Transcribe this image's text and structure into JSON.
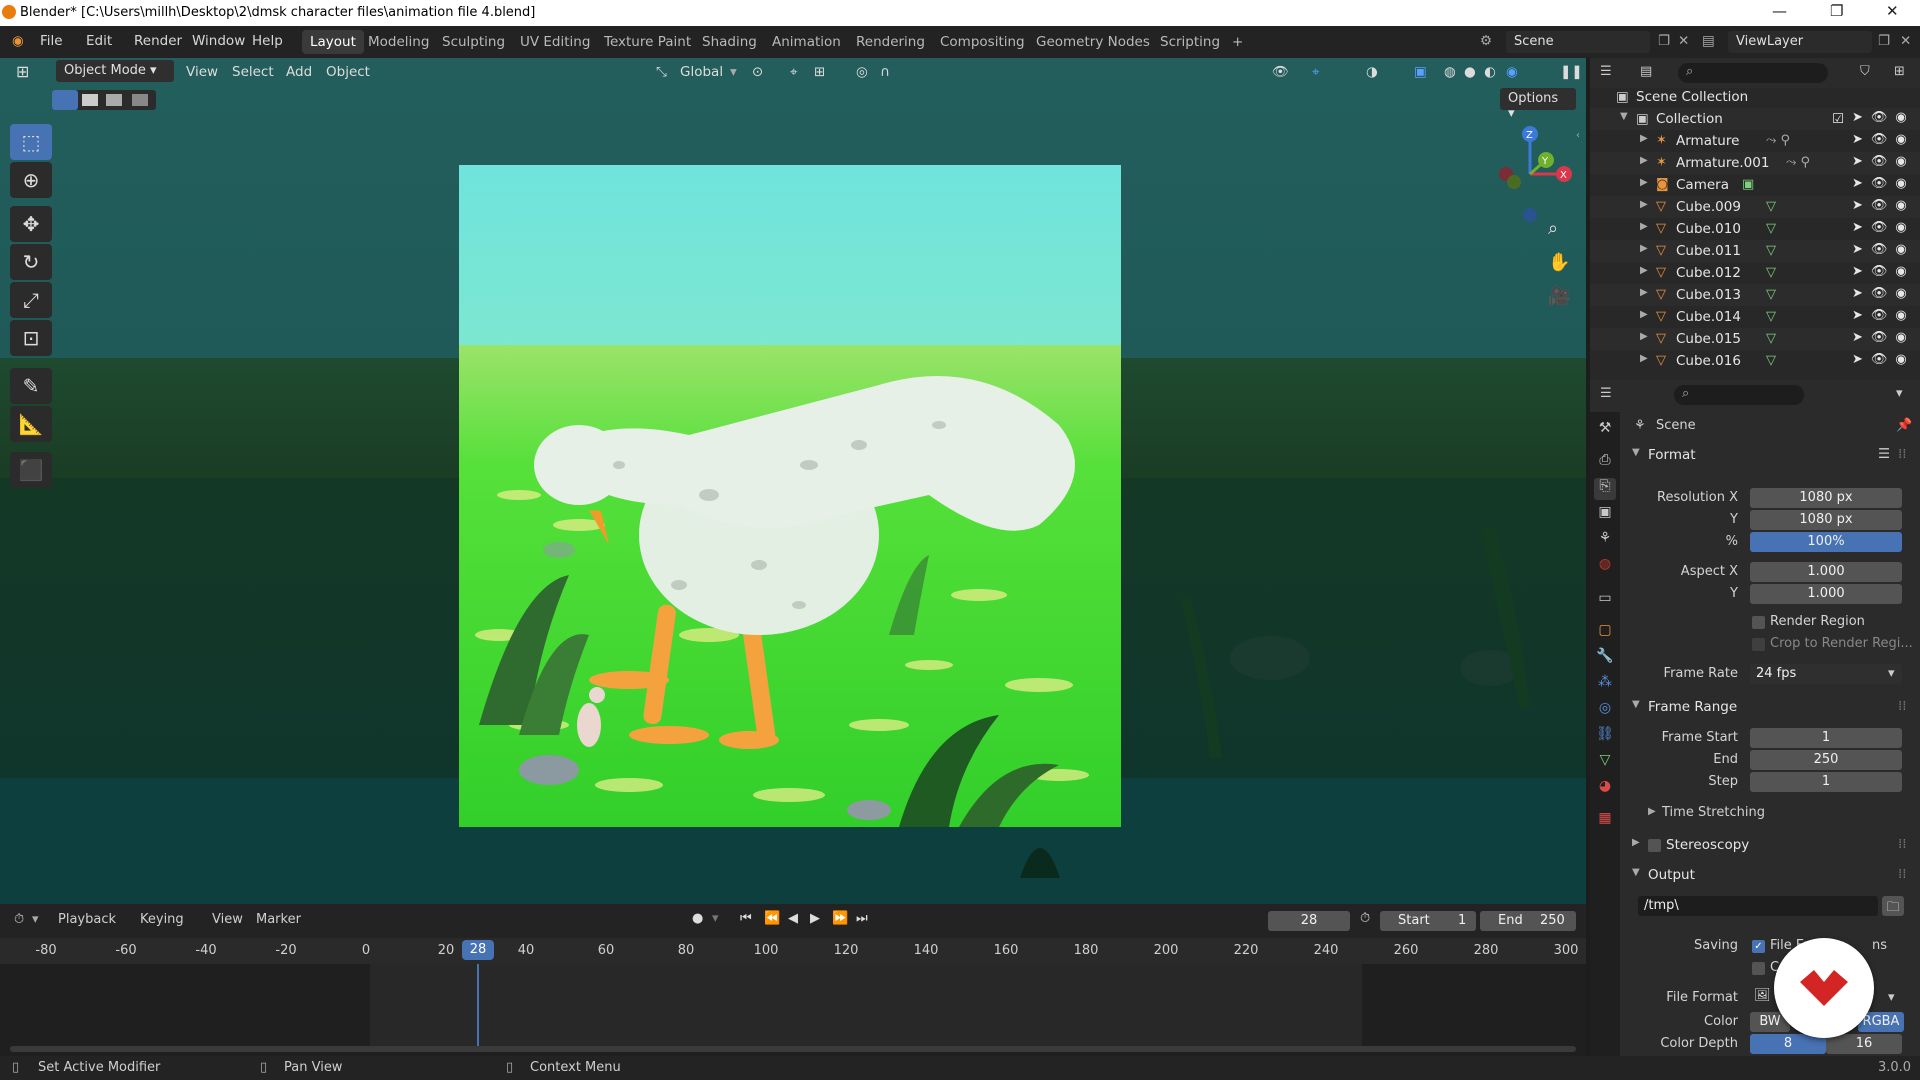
{
  "window": {
    "title": "Blender* [C:\\Users\\millh\\Desktop\\2\\dmsk character files\\animation file 4.blend]",
    "controls": [
      "—",
      "❐",
      "✕"
    ]
  },
  "menu": [
    "File",
    "Edit",
    "Render",
    "Window",
    "Help"
  ],
  "workspaces": [
    "Layout",
    "Modeling",
    "Sculpting",
    "UV Editing",
    "Texture Paint",
    "Shading",
    "Animation",
    "Rendering",
    "Compositing",
    "Geometry Nodes",
    "Scripting"
  ],
  "active_workspace": "Layout",
  "add_workspace": "+",
  "scene_field": "Scene",
  "viewlayer_field": "ViewLayer",
  "viewport_header": {
    "mode": "Object Mode",
    "menus": [
      "View",
      "Select",
      "Add",
      "Object"
    ],
    "transform": "Global",
    "options": "Options"
  },
  "gizmo": {
    "z": "Z",
    "y": "Y",
    "x": "X"
  },
  "tools": [
    "select-box",
    "cursor",
    "move",
    "rotate",
    "scale",
    "transform",
    "annotate",
    "measure",
    "add-cube"
  ],
  "outliner": {
    "root": "Scene Collection",
    "collection": "Collection",
    "items": [
      {
        "name": "Armature",
        "icon": "armature-icon"
      },
      {
        "name": "Armature.001",
        "icon": "armature-icon"
      },
      {
        "name": "Camera",
        "icon": "camera-icon"
      },
      {
        "name": "Cube.009",
        "icon": "mesh-icon"
      },
      {
        "name": "Cube.010",
        "icon": "mesh-icon"
      },
      {
        "name": "Cube.011",
        "icon": "mesh-icon"
      },
      {
        "name": "Cube.012",
        "icon": "mesh-icon"
      },
      {
        "name": "Cube.013",
        "icon": "mesh-icon"
      },
      {
        "name": "Cube.014",
        "icon": "mesh-icon"
      },
      {
        "name": "Cube.015",
        "icon": "mesh-icon"
      },
      {
        "name": "Cube.016",
        "icon": "mesh-icon"
      }
    ]
  },
  "properties": {
    "context": "Scene",
    "format": {
      "title": "Format",
      "res_x_label": "Resolution X",
      "res_x": "1080 px",
      "res_y_label": "Y",
      "res_y": "1080 px",
      "res_pct_label": "%",
      "res_pct": "100%",
      "aspect_x_label": "Aspect X",
      "aspect_x": "1.000",
      "aspect_y_label": "Y",
      "aspect_y": "1.000",
      "render_region": "Render Region",
      "crop": "Crop to Render Regi...",
      "frame_rate_label": "Frame Rate",
      "frame_rate": "24 fps"
    },
    "frame_range": {
      "title": "Frame Range",
      "start_label": "Frame Start",
      "start": "1",
      "end_label": "End",
      "end": "250",
      "step_label": "Step",
      "step": "1",
      "time_stretching": "Time Stretching"
    },
    "stereoscopy": "Stereoscopy",
    "output": {
      "title": "Output",
      "path": "/tmp\\",
      "saving_label": "Saving",
      "file_ext": "File Ext",
      "file_ext_tail": "ns",
      "cache_short": "C",
      "file_format_label": "File Format",
      "color_label": "Color",
      "color_bw": "BW",
      "color_rgba": "RGBA",
      "color_depth_label": "Color Depth",
      "depth_8": "8",
      "depth_16": "16"
    }
  },
  "timeline": {
    "menus": [
      "Playback",
      "Keying",
      "View",
      "Marker"
    ],
    "current_frame": "28",
    "start_label": "Start",
    "start": "1",
    "end_label": "End",
    "end": "250",
    "ticks": [
      "-80",
      "-60",
      "-40",
      "-20",
      "0",
      "20",
      "40",
      "60",
      "80",
      "100",
      "120",
      "140",
      "160",
      "180",
      "200",
      "220",
      "240",
      "260",
      "280",
      "300"
    ],
    "playhead": "28"
  },
  "status": {
    "left": "Set Active Modifier",
    "middle": "Pan View",
    "right": "Context Menu",
    "version": "3.0.0"
  },
  "colors": {
    "accent": "#4772b3",
    "viewport_bg": "#0f4443",
    "sky": "#6fe3dc",
    "grass": "#3fd63a"
  }
}
